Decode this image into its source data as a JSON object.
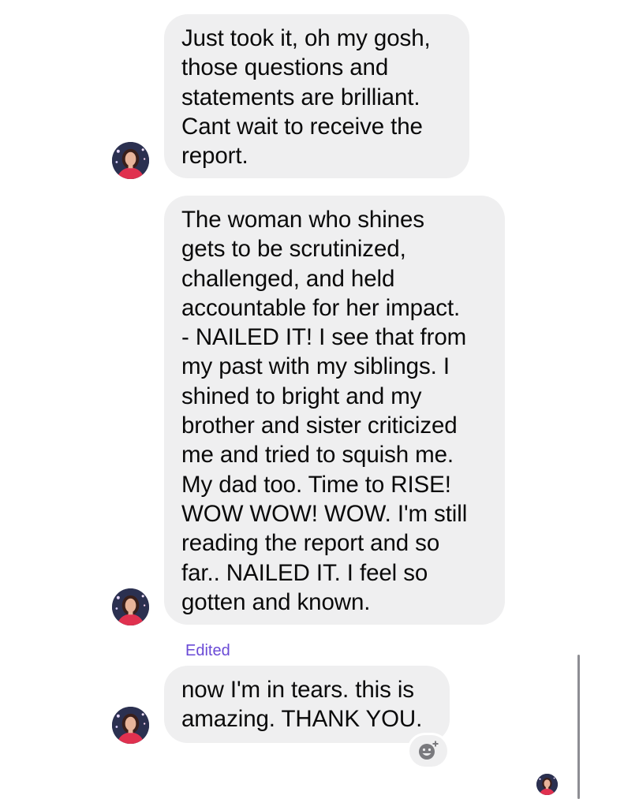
{
  "conversation": {
    "messages": [
      {
        "text": "Just took it, oh my gosh,\nthose questions and\nstatements are brilliant.\nCant wait to receive the\nreport.",
        "edited": false
      },
      {
        "text": "The woman who shines\ngets to be scrutinized,\nchallenged, and held\naccountable for her impact.\n- NAILED IT!  I see that from\nmy past with my siblings. I\nshined to bright and my\nbrother and sister criticized\nme and tried to squish me.\nMy dad too. Time to RISE!\nWOW WOW! WOW. I'm still\nreading the report and so\nfar.. NAILED IT. I feel so\ngotten and known.",
        "edited": false
      },
      {
        "text": "now I'm in tears. this is\namazing. THANK YOU.",
        "edited": true
      }
    ],
    "edited_label": "Edited"
  },
  "icons": {
    "reaction": "add-reaction-smiley-icon",
    "avatar": "sender-avatar-photo",
    "read_receipt": "read-receipt-avatar"
  },
  "colors": {
    "bubble_background": "#efeff0",
    "message_text": "#0a0a0a",
    "edited_label": "#6a4ad6",
    "scrollbar": "#8e8e93"
  }
}
